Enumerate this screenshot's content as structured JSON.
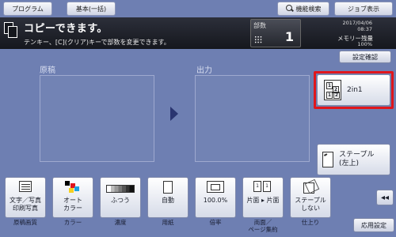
{
  "tabs": {
    "program": "プログラム",
    "basic": "基本(一括)",
    "function_search": "機能検索",
    "job_display": "ジョブ表示"
  },
  "status": {
    "title": "コピーできます。",
    "subtitle": "テンキー、[C](クリア)キーで部数を変更できます。",
    "copies_label": "部数",
    "copies_value": "1",
    "date": "2017/04/06",
    "time": "08:37",
    "memory_label": "メモリー残量",
    "memory_value": "100%"
  },
  "setting_confirm": "設定確認",
  "preview": {
    "original_label": "原稿",
    "output_label": "出力"
  },
  "side_buttons": {
    "two_in_one": "2in1",
    "two_in_one_pages": [
      "1",
      "2",
      "1",
      "2"
    ],
    "staple_line1": "ステープル",
    "staple_line2": "(左上)"
  },
  "function_buttons": [
    {
      "line1": "文字／写真",
      "line2": "印刷写真",
      "caption": "原稿画質",
      "icon": "document-icon"
    },
    {
      "line1": "オート",
      "line2": "カラー",
      "caption": "カラー",
      "icon": "auto-color-icon"
    },
    {
      "line1": "ふつう",
      "line2": "",
      "caption": "濃度",
      "icon": "density-icon"
    },
    {
      "line1": "自動",
      "line2": "",
      "caption": "用紙",
      "icon": "paper-icon"
    },
    {
      "line1": "100.0%",
      "line2": "",
      "caption": "倍率",
      "icon": "zoom-icon"
    },
    {
      "line1": "片面 ▸ 片面",
      "line2": "",
      "caption_line1": "両面／",
      "caption_line2": "ページ集約",
      "icon": "duplex-icon"
    },
    {
      "line1": "ステープル",
      "line2": "しない",
      "caption": "仕上り",
      "icon": "staple-icon"
    }
  ],
  "duplex_pages": [
    "1",
    "1"
  ],
  "collapse_label": "◂◂",
  "apply_settings": "応用設定",
  "colors": {
    "background": "#6e7fb2",
    "status_bar": "#15171d",
    "highlight": "#e0161c",
    "arrow": "#2a3570"
  }
}
